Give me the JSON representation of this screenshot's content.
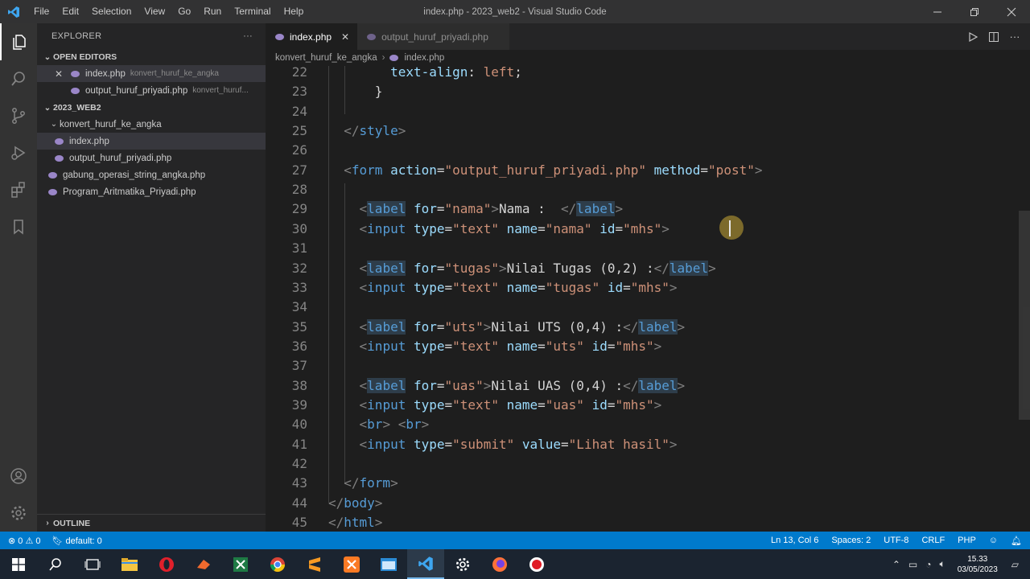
{
  "window": {
    "title": "index.php - 2023_web2 - Visual Studio Code",
    "menu": [
      "File",
      "Edit",
      "Selection",
      "View",
      "Go",
      "Run",
      "Terminal",
      "Help"
    ]
  },
  "sidebar": {
    "header": "EXPLORER",
    "more": "···",
    "open_editors_label": "OPEN EDITORS",
    "open_editors": [
      {
        "name": "index.php",
        "folder": "konvert_huruf_ke_angka"
      },
      {
        "name": "output_huruf_priyadi.php",
        "folder": "konvert_huruf..."
      }
    ],
    "workspace_label": "2023_WEB2",
    "tree": [
      {
        "name": "konvert_huruf_ke_angka",
        "type": "folder"
      },
      {
        "name": "index.php",
        "type": "file"
      },
      {
        "name": "output_huruf_priyadi.php",
        "type": "file"
      },
      {
        "name": "gabung_operasi_string_angka.php",
        "type": "file"
      },
      {
        "name": "Program_Aritmatika_Priyadi.php",
        "type": "file"
      }
    ],
    "outline_label": "OUTLINE"
  },
  "tabs": [
    {
      "label": "index.php",
      "active": true
    },
    {
      "label": "output_huruf_priyadi.php",
      "active": false
    }
  ],
  "breadcrumb": [
    "konvert_huruf_ke_angka",
    "index.php"
  ],
  "editor": {
    "lines": [
      {
        "n": "22",
        "html": "        <span class='t-prop'>text-align</span><span class='t-text'>: </span><span class='t-val'>left</span><span class='t-text'>;</span>"
      },
      {
        "n": "23",
        "html": "      <span class='t-text'>}</span>"
      },
      {
        "n": "24",
        "html": ""
      },
      {
        "n": "25",
        "html": "  <span class='t-punc'>&lt;/</span><span class='t-tag'>style</span><span class='t-punc'>&gt;</span>"
      },
      {
        "n": "26",
        "html": ""
      },
      {
        "n": "27",
        "html": "  <span class='t-punc'>&lt;</span><span class='t-tag'>form</span> <span class='t-attr'>action</span><span class='t-text'>=</span><span class='t-str'>\"output_huruf_priyadi.php\"</span> <span class='t-attr'>method</span><span class='t-text'>=</span><span class='t-str'>\"post\"</span><span class='t-punc'>&gt;</span>"
      },
      {
        "n": "28",
        "html": ""
      },
      {
        "n": "29",
        "html": "    <span class='t-punc'>&lt;</span><span class='t-tagh'>label</span> <span class='t-attr'>for</span><span class='t-text'>=</span><span class='t-str'>\"nama\"</span><span class='t-punc'>&gt;</span><span class='t-text'>Nama :  </span><span class='t-punc'>&lt;/</span><span class='t-tagh'>label</span><span class='t-punc'>&gt;</span>"
      },
      {
        "n": "30",
        "html": "    <span class='t-punc'>&lt;</span><span class='t-tag'>input</span> <span class='t-attr'>type</span><span class='t-text'>=</span><span class='t-str'>\"text\"</span> <span class='t-attr'>name</span><span class='t-text'>=</span><span class='t-str'>\"nama\"</span> <span class='t-attr'>id</span><span class='t-text'>=</span><span class='t-str'>\"mhs\"</span><span class='t-punc'>&gt;</span>"
      },
      {
        "n": "31",
        "html": ""
      },
      {
        "n": "32",
        "html": "    <span class='t-punc'>&lt;</span><span class='t-tagh'>label</span> <span class='t-attr'>for</span><span class='t-text'>=</span><span class='t-str'>\"tugas\"</span><span class='t-punc'>&gt;</span><span class='t-text'>Nilai Tugas (0,2) :</span><span class='t-punc'>&lt;/</span><span class='t-tagh'>label</span><span class='t-punc'>&gt;</span>"
      },
      {
        "n": "33",
        "html": "    <span class='t-punc'>&lt;</span><span class='t-tag'>input</span> <span class='t-attr'>type</span><span class='t-text'>=</span><span class='t-str'>\"text\"</span> <span class='t-attr'>name</span><span class='t-text'>=</span><span class='t-str'>\"tugas\"</span> <span class='t-attr'>id</span><span class='t-text'>=</span><span class='t-str'>\"mhs\"</span><span class='t-punc'>&gt;</span>"
      },
      {
        "n": "34",
        "html": ""
      },
      {
        "n": "35",
        "html": "    <span class='t-punc'>&lt;</span><span class='t-tagh'>label</span> <span class='t-attr'>for</span><span class='t-text'>=</span><span class='t-str'>\"uts\"</span><span class='t-punc'>&gt;</span><span class='t-text'>Nilai UTS (0,4) :</span><span class='t-punc'>&lt;/</span><span class='t-tagh'>label</span><span class='t-punc'>&gt;</span>"
      },
      {
        "n": "36",
        "html": "    <span class='t-punc'>&lt;</span><span class='t-tag'>input</span> <span class='t-attr'>type</span><span class='t-text'>=</span><span class='t-str'>\"text\"</span> <span class='t-attr'>name</span><span class='t-text'>=</span><span class='t-str'>\"uts\"</span> <span class='t-attr'>id</span><span class='t-text'>=</span><span class='t-str'>\"mhs\"</span><span class='t-punc'>&gt;</span>"
      },
      {
        "n": "37",
        "html": ""
      },
      {
        "n": "38",
        "html": "    <span class='t-punc'>&lt;</span><span class='t-tagh'>label</span> <span class='t-attr'>for</span><span class='t-text'>=</span><span class='t-str'>\"uas\"</span><span class='t-punc'>&gt;</span><span class='t-text'>Nilai UAS (0,4) :</span><span class='t-punc'>&lt;/</span><span class='t-tagh'>label</span><span class='t-punc'>&gt;</span>"
      },
      {
        "n": "39",
        "html": "    <span class='t-punc'>&lt;</span><span class='t-tag'>input</span> <span class='t-attr'>type</span><span class='t-text'>=</span><span class='t-str'>\"text\"</span> <span class='t-attr'>name</span><span class='t-text'>=</span><span class='t-str'>\"uas\"</span> <span class='t-attr'>id</span><span class='t-text'>=</span><span class='t-str'>\"mhs\"</span><span class='t-punc'>&gt;</span>"
      },
      {
        "n": "40",
        "html": "    <span class='t-punc'>&lt;</span><span class='t-tag'>br</span><span class='t-punc'>&gt;</span> <span class='t-punc'>&lt;</span><span class='t-tag'>br</span><span class='t-punc'>&gt;</span>"
      },
      {
        "n": "41",
        "html": "    <span class='t-punc'>&lt;</span><span class='t-tag'>input</span> <span class='t-attr'>type</span><span class='t-text'>=</span><span class='t-str'>\"submit\"</span> <span class='t-attr'>value</span><span class='t-text'>=</span><span class='t-str'>\"Lihat hasil\"</span><span class='t-punc'>&gt;</span>"
      },
      {
        "n": "42",
        "html": ""
      },
      {
        "n": "43",
        "html": "  <span class='t-punc'>&lt;/</span><span class='t-tag'>form</span><span class='t-punc'>&gt;</span>"
      },
      {
        "n": "44",
        "html": "<span class='t-punc'>&lt;/</span><span class='t-tag'>body</span><span class='t-punc'>&gt;</span>"
      },
      {
        "n": "45",
        "html": "<span class='t-punc'>&lt;/</span><span class='t-tag'>html</span><span class='t-punc'>&gt;</span>"
      }
    ]
  },
  "status": {
    "problems": "⊗ 0 ⚠ 0",
    "branch": "default: 0",
    "position": "Ln 13, Col 6",
    "spaces": "Spaces: 2",
    "encoding": "UTF-8",
    "eol": "CRLF",
    "language": "PHP"
  },
  "taskbar": {
    "time": "15.33",
    "date": "03/05/2023"
  },
  "colors": {
    "status_bar": "#007acc",
    "editor_bg": "#1e1e1e",
    "sidebar_bg": "#252526",
    "activity_bg": "#333333"
  }
}
